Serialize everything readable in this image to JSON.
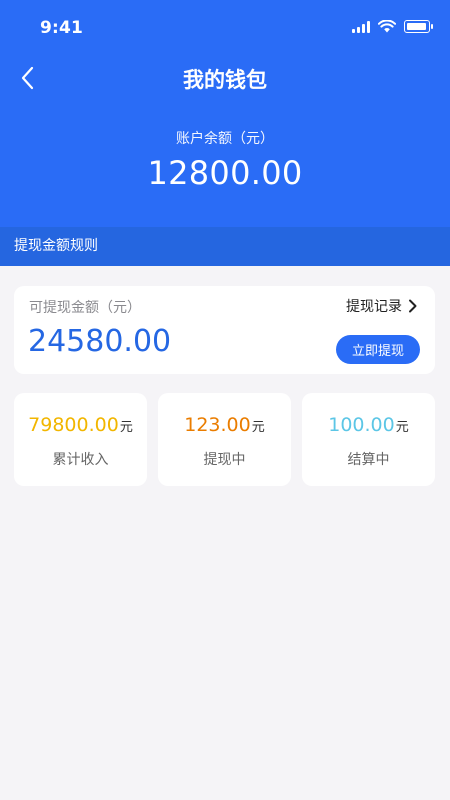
{
  "status_bar": {
    "time": "9:41"
  },
  "nav": {
    "title": "我的钱包"
  },
  "balance": {
    "label": "账户余额（元）",
    "value": "12800.00"
  },
  "rules": {
    "label": "提现金额规则"
  },
  "withdraw": {
    "label": "可提现金额（元）",
    "amount": "24580.00",
    "record_label": "提现记录",
    "button_label": "立即提现"
  },
  "stats": [
    {
      "value": "79800.00",
      "unit": "元",
      "label": "累计收入",
      "color": "#f2b600"
    },
    {
      "value": "123.00",
      "unit": "元",
      "label": "提现中",
      "color": "#ea7d00"
    },
    {
      "value": "100.00",
      "unit": "元",
      "label": "结算中",
      "color": "#5cc6e6"
    }
  ],
  "colors": {
    "primary": "#2a6cf6",
    "rules_bar": "#2566e0",
    "amount_blue": "#2567e3"
  }
}
